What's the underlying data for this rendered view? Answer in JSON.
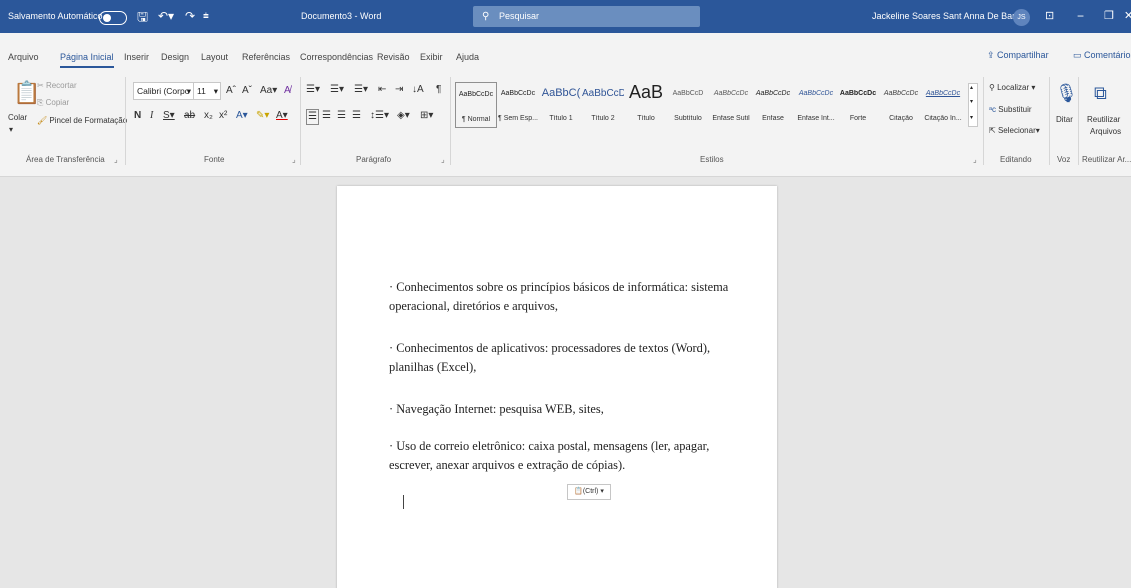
{
  "titlebar": {
    "autosave_label": "Salvamento Automático",
    "doc_title": "Documento3 - Word",
    "search_placeholder": "Pesquisar",
    "user_name": "Jackeline Soares Sant Anna De Barros",
    "user_initials": "JS"
  },
  "tabs": [
    "Arquivo",
    "Página Inicial",
    "Inserir",
    "Design",
    "Layout",
    "Referências",
    "Correspondências",
    "Revisão",
    "Exibir",
    "Ajuda"
  ],
  "active_tab": "Página Inicial",
  "share_label": "Compartilhar",
  "comments_label": "Comentários",
  "clipboard": {
    "paste": "Colar",
    "cut": "Recortar",
    "copy": "Copiar",
    "format_painter": "Pincel de Formatação",
    "group": "Área de Transferência"
  },
  "font": {
    "name": "Calibri (Corpo",
    "size": "11",
    "group": "Fonte"
  },
  "paragraph": {
    "group": "Parágrafo"
  },
  "styles": {
    "group": "Estilos",
    "items": [
      {
        "preview": "AaBbCcDc",
        "name": "¶ Normal"
      },
      {
        "preview": "AaBbCcDc",
        "name": "¶ Sem Esp..."
      },
      {
        "preview": "AaBbC(",
        "name": "Título 1"
      },
      {
        "preview": "AaBbCcD",
        "name": "Título 2"
      },
      {
        "preview": "AaB",
        "name": "Título"
      },
      {
        "preview": "AaBbCcD",
        "name": "Subtítulo"
      },
      {
        "preview": "AaBbCcDc",
        "name": "Ênfase Sutil"
      },
      {
        "preview": "AaBbCcDc",
        "name": "Ênfase"
      },
      {
        "preview": "AaBbCcDc",
        "name": "Ênfase Int..."
      },
      {
        "preview": "AaBbCcDc",
        "name": "Forte"
      },
      {
        "preview": "AaBbCcDc",
        "name": "Citação"
      },
      {
        "preview": "AaBbCcDc",
        "name": "Citação In..."
      }
    ]
  },
  "editing": {
    "find": "Localizar",
    "replace": "Substituir",
    "select": "Selecionar",
    "group": "Editando"
  },
  "voice": {
    "dictate": "Ditar",
    "group": "Voz"
  },
  "reuse": {
    "line1": "Reutilizar",
    "line2": "Arquivos",
    "group": "Reutilizar Ar..."
  },
  "document": {
    "paragraphs": [
      "· Conhecimentos sobre os princípios básicos de informática: sistema operacional, diretórios e arquivos,",
      "· Conhecimentos de aplicativos: processadores de textos (Word), planilhas (Excel),",
      "· Navegação Internet: pesquisa WEB, sites,",
      "· Uso de correio eletrônico: caixa postal, mensagens (ler, apagar, escrever, anexar arquivos e extração de cópias)."
    ],
    "paste_options": "(Ctrl) ▾"
  },
  "colors": {
    "title_bar": "#2b579a",
    "ribbon": "#f3f3f3",
    "canvas": "#e6e6e6"
  }
}
